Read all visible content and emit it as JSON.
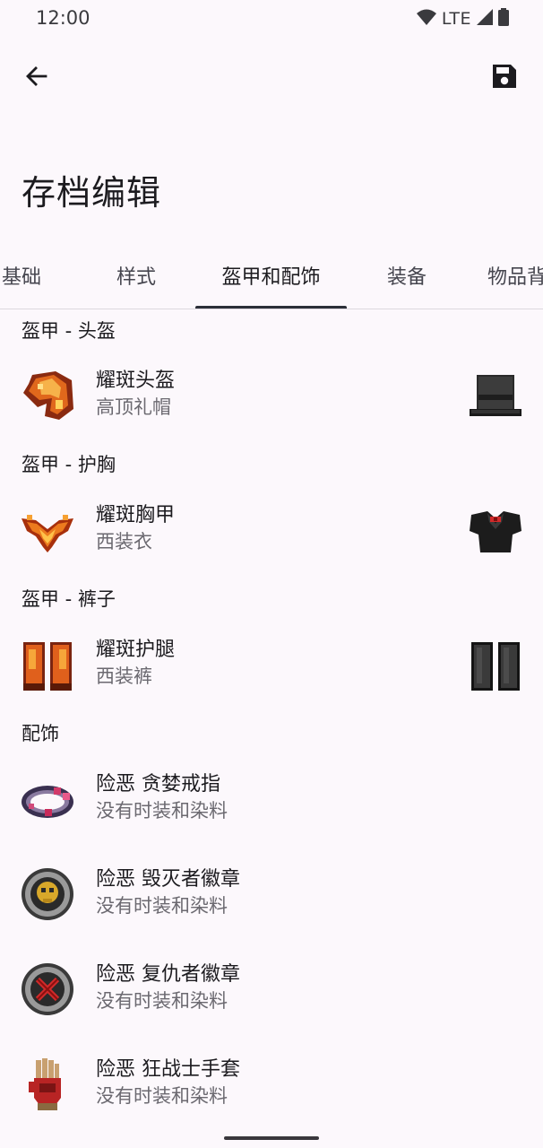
{
  "status": {
    "time": "12:00",
    "network": "LTE"
  },
  "appbar": {
    "back_icon": "arrow-left-icon",
    "save_icon": "floppy-disk-save-icon"
  },
  "title": "存档编辑",
  "tabs": [
    {
      "label": "基础"
    },
    {
      "label": "样式"
    },
    {
      "label": "盔甲和配饰"
    },
    {
      "label": "装备"
    },
    {
      "label": "物品背"
    }
  ],
  "active_tab": "盔甲和配饰",
  "sections": {
    "helmet": {
      "header": "盔甲 - 头盔",
      "item": {
        "name": "耀斑头盔",
        "vanity": "高顶礼帽",
        "icon": "solar-flare-helmet-icon",
        "vanity_icon": "top-hat-icon"
      }
    },
    "chest": {
      "header": "盔甲 - 护胸",
      "item": {
        "name": "耀斑胸甲",
        "vanity": "西装衣",
        "icon": "solar-flare-breastplate-icon",
        "vanity_icon": "tuxedo-shirt-icon"
      }
    },
    "legs": {
      "header": "盔甲 - 裤子",
      "item": {
        "name": "耀斑护腿",
        "vanity": "西装裤",
        "icon": "solar-flare-leggings-icon",
        "vanity_icon": "tuxedo-pants-icon"
      }
    },
    "accessories": {
      "header": "配饰",
      "items": [
        {
          "name": "险恶 贪婪戒指",
          "vanity": "没有时装和染料",
          "icon": "greedy-ring-icon"
        },
        {
          "name": "险恶 毁灭者徽章",
          "vanity": "没有时装和染料",
          "icon": "destroyer-emblem-icon"
        },
        {
          "name": "险恶 复仇者徽章",
          "vanity": "没有时装和染料",
          "icon": "avenger-emblem-icon"
        },
        {
          "name": "险恶 狂战士手套",
          "vanity": "没有时装和染料",
          "icon": "berserker-glove-icon"
        }
      ]
    }
  },
  "colors": {
    "background": "#fcf8fc",
    "tab_indicator": "#2b2f38",
    "secondary_text": "#6b6970"
  }
}
